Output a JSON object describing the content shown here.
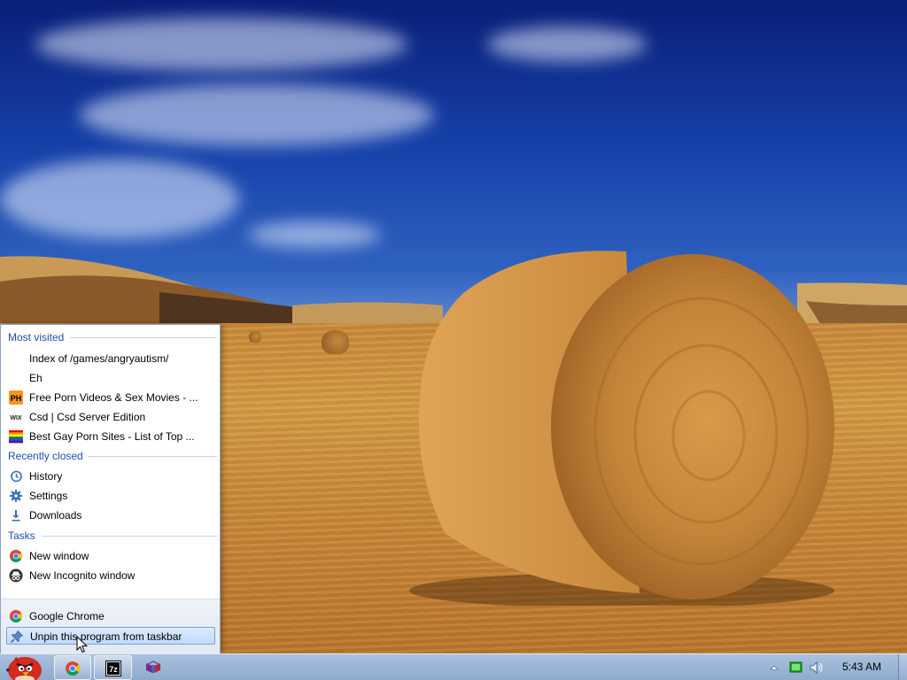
{
  "jump_list": {
    "most_visited": {
      "label": "Most visited",
      "items": [
        {
          "label": "Index of /games/angryautism/",
          "icon": "blank-page-icon"
        },
        {
          "label": "Eh",
          "icon": "blank-page-icon"
        },
        {
          "label": "Free Porn Videos & Sex Movies - ...",
          "icon": "ph-favicon-icon",
          "icon_text": "PH"
        },
        {
          "label": "Csd | Csd Server Edition",
          "icon": "wix-favicon-icon",
          "icon_text": "WIX"
        },
        {
          "label": "Best Gay Porn Sites - List of Top ...",
          "icon": "rainbow-flag-icon"
        }
      ]
    },
    "recently_closed": {
      "label": "Recently closed",
      "items": [
        {
          "label": "History",
          "icon": "clock-icon"
        },
        {
          "label": "Settings",
          "icon": "gear-icon"
        },
        {
          "label": "Downloads",
          "icon": "download-arrow-icon"
        }
      ]
    },
    "tasks": {
      "label": "Tasks",
      "items": [
        {
          "label": "New window",
          "icon": "chrome-icon"
        },
        {
          "label": "New Incognito window",
          "icon": "incognito-icon"
        }
      ]
    },
    "bottom": {
      "app_label": "Google Chrome",
      "unpin_label": "Unpin this program from taskbar"
    }
  },
  "taskbar": {
    "buttons": [
      {
        "name": "angry-bird-start-orb",
        "icon": "angry-bird-icon"
      },
      {
        "name": "chrome",
        "icon": "chrome-icon",
        "pinned": true
      },
      {
        "name": "7zip",
        "icon": "7zip-icon",
        "icon_text": "7z"
      },
      {
        "name": "winrar",
        "icon": "winrar-icon"
      }
    ],
    "tray": {
      "time": "5:43 AM",
      "icons": [
        "show-hidden-icons-arrow",
        "network-icon",
        "volume-icon"
      ]
    }
  },
  "colors": {
    "section_label": "#1e4fa8",
    "taskbar": "#9fb8d8",
    "selection": "#c1dbfc"
  }
}
